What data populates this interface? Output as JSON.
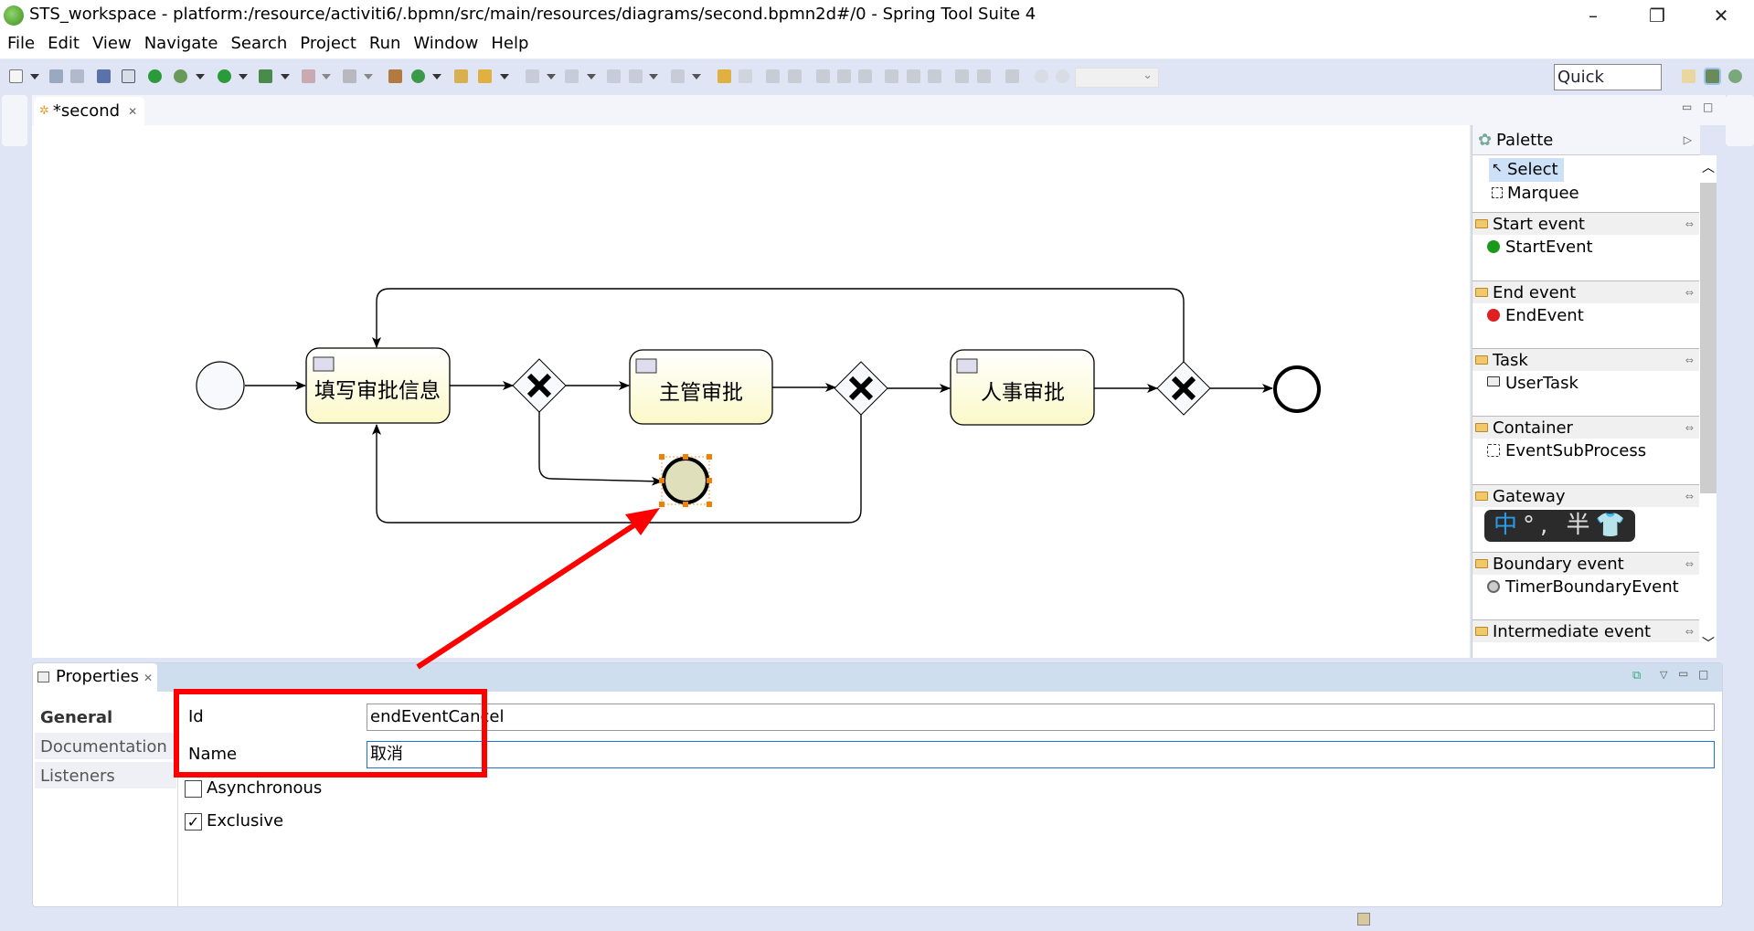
{
  "window": {
    "title": "STS_workspace - platform:/resource/activiti6/.bpmn/src/main/resources/diagrams/second.bpmn2d#/0 - Spring Tool Suite 4",
    "minimize": "–",
    "restore": "❐",
    "close": "✕"
  },
  "menu": [
    "File",
    "Edit",
    "View",
    "Navigate",
    "Search",
    "Project",
    "Run",
    "Window",
    "Help"
  ],
  "toolbar": {
    "quick_access": "Quick Access",
    "zoom_value": ""
  },
  "editor": {
    "tab_label": "*second"
  },
  "diagram": {
    "tasks": [
      "填写审批信息",
      "主管审批",
      "人事审批"
    ],
    "selected_fill": "#e0dfbc",
    "task_fill": "#fdfcd8"
  },
  "palette": {
    "title": "Palette",
    "tools": [
      "Select",
      "Marquee"
    ],
    "drawers": [
      {
        "label": "Start event",
        "item": "StartEvent"
      },
      {
        "label": "End event",
        "item": "EndEvent"
      },
      {
        "label": "Task",
        "item": "UserTask"
      },
      {
        "label": "Container",
        "item": "EventSubProcess"
      },
      {
        "label": "Gateway",
        "item": ""
      },
      {
        "label": "Boundary event",
        "item": "TimerBoundaryEvent"
      },
      {
        "label": "Intermediate event",
        "item": ""
      }
    ],
    "ime": {
      "mode": "中",
      "rest": "°, 半"
    }
  },
  "properties": {
    "tab_label": "Properties",
    "nav": [
      "General",
      "Documentation",
      "Listeners"
    ],
    "id_label": "Id",
    "id_value": "endEventCancel",
    "name_label": "Name",
    "name_value": "取消",
    "asynchronous_label": "Asynchronous",
    "asynchronous_checked": false,
    "exclusive_label": "Exclusive",
    "exclusive_checked": true
  },
  "annotation_color": "#ff0000"
}
